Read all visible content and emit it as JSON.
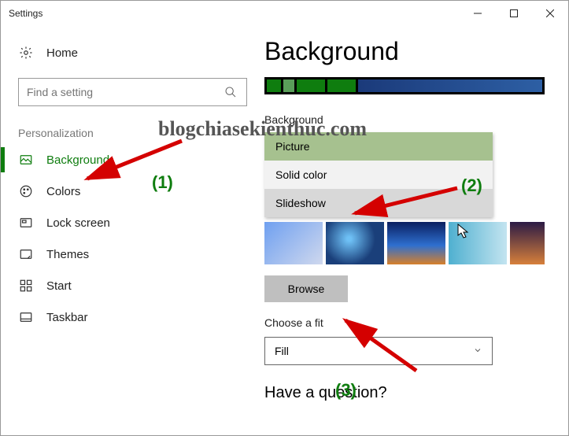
{
  "window": {
    "title": "Settings"
  },
  "sidebar": {
    "home": "Home",
    "search_placeholder": "Find a setting",
    "section": "Personalization",
    "items": [
      {
        "label": "Background",
        "active": true
      },
      {
        "label": "Colors"
      },
      {
        "label": "Lock screen"
      },
      {
        "label": "Themes"
      },
      {
        "label": "Start"
      },
      {
        "label": "Taskbar"
      }
    ]
  },
  "main": {
    "title": "Background",
    "bg_label": "Background",
    "dropdown": {
      "options": [
        "Picture",
        "Solid color",
        "Slideshow"
      ],
      "selected": "Picture"
    },
    "browse": "Browse",
    "fit_label": "Choose a fit",
    "fit_value": "Fill",
    "question": "Have a question?"
  },
  "watermark": "blogchiasekienthuc.com",
  "markers": {
    "one": "(1)",
    "two": "(2)",
    "three": "(3)"
  }
}
